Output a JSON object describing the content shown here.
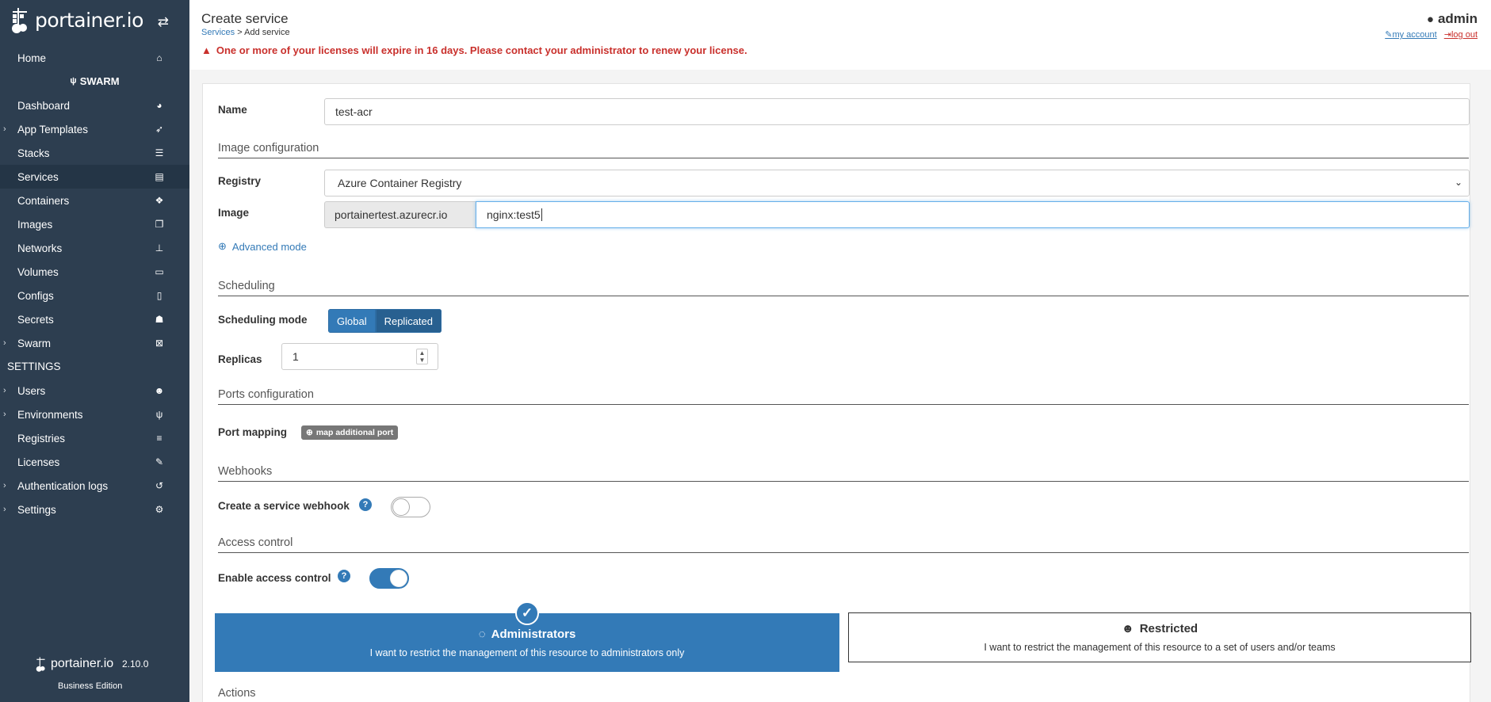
{
  "sidebar": {
    "brand": "portainer.io",
    "home": "Home",
    "swarm_header": "SWARM",
    "items": [
      {
        "label": "Dashboard",
        "icon": "dashboard-icon"
      },
      {
        "label": "App Templates",
        "icon": "rocket-icon"
      },
      {
        "label": "Stacks",
        "icon": "list-icon"
      },
      {
        "label": "Services",
        "icon": "services-icon"
      },
      {
        "label": "Containers",
        "icon": "cubes-icon"
      },
      {
        "label": "Images",
        "icon": "clone-icon"
      },
      {
        "label": "Networks",
        "icon": "sitemap-icon"
      },
      {
        "label": "Volumes",
        "icon": "hdd-icon"
      },
      {
        "label": "Configs",
        "icon": "file-icon"
      },
      {
        "label": "Secrets",
        "icon": "user-secret-icon"
      },
      {
        "label": "Swarm",
        "icon": "object-group-icon"
      }
    ],
    "settings_header": "SETTINGS",
    "settings_items": [
      {
        "label": "Users",
        "icon": "users-icon"
      },
      {
        "label": "Environments",
        "icon": "plug-icon"
      },
      {
        "label": "Registries",
        "icon": "database-icon"
      },
      {
        "label": "Licenses",
        "icon": "file-signature-icon"
      },
      {
        "label": "Authentication logs",
        "icon": "history-icon"
      },
      {
        "label": "Settings",
        "icon": "cogs-icon"
      }
    ],
    "footer": {
      "brand": "portainer.io",
      "version": "2.10.0",
      "edition": "Business Edition"
    }
  },
  "header": {
    "title": "Create service",
    "breadcrumb_link": "Services",
    "breadcrumb_sep": ">",
    "breadcrumb_current": "Add service",
    "license_warning": "One or more of your licenses will expire in 16 days. Please contact your administrator to renew your license.",
    "user": "admin",
    "my_account": "my account",
    "log_out": "log out"
  },
  "form": {
    "name_label": "Name",
    "name_value": "test-acr",
    "image_config_title": "Image configuration",
    "registry_label": "Registry",
    "registry_value": "Azure Container Registry",
    "image_label": "Image",
    "image_prefix": "portainertest.azurecr.io",
    "image_value": "nginx:test5",
    "advanced_mode": "Advanced mode",
    "scheduling_title": "Scheduling",
    "scheduling_mode_label": "Scheduling mode",
    "mode_global": "Global",
    "mode_replicated": "Replicated",
    "replicas_label": "Replicas",
    "replicas_value": "1",
    "ports_title": "Ports configuration",
    "port_mapping_label": "Port mapping",
    "map_port_button": "map additional port",
    "webhooks_title": "Webhooks",
    "webhook_label": "Create a service webhook",
    "webhook_enabled": false,
    "access_title": "Access control",
    "access_label": "Enable access control",
    "access_enabled": true,
    "admins_title": "Administrators",
    "admins_desc": "I want to restrict the management of this resource to administrators only",
    "restricted_title": "Restricted",
    "restricted_desc": "I want to restrict the management of this resource to a set of users and/or teams",
    "actions_title": "Actions"
  },
  "colors": {
    "sidebar": "#2d3e50",
    "primary": "#337ab7",
    "danger": "#c9302c"
  }
}
